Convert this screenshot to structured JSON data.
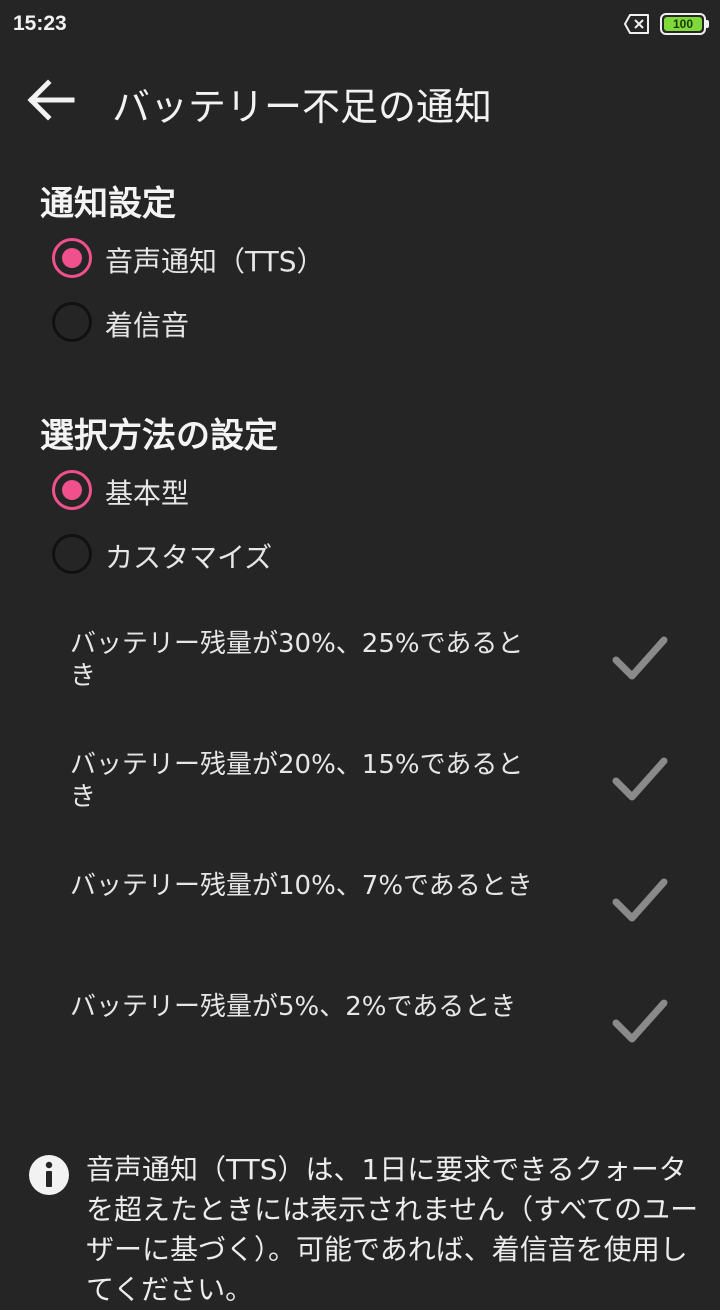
{
  "status": {
    "time": "15:23",
    "battery_level": "100"
  },
  "header": {
    "title": "バッテリー不足の通知"
  },
  "notification_settings": {
    "title": "通知設定",
    "options": [
      {
        "label": "音声通知（TTS）",
        "selected": true
      },
      {
        "label": "着信音",
        "selected": false
      }
    ]
  },
  "selection_method": {
    "title": "選択方法の設定",
    "options": [
      {
        "label": "基本型",
        "selected": true
      },
      {
        "label": "カスタマイズ",
        "selected": false
      }
    ]
  },
  "thresholds": [
    {
      "label": "バッテリー残量が30%、25%であるとき",
      "checked": true
    },
    {
      "label": "バッテリー残量が20%、15%であるとき",
      "checked": true
    },
    {
      "label": "バッテリー残量が10%、7%であるとき",
      "checked": true
    },
    {
      "label": "バッテリー残量が5%、2%であるとき",
      "checked": true
    }
  ],
  "info": {
    "text": "音声通知（TTS）は、1日に要求できるクォータを超えたときには表示されません（すべてのユーザーに基づく）。可能であれば、着信音を使用してください。"
  },
  "colors": {
    "background": "#252525",
    "accent": "#f0508c",
    "battery": "#7fd93a",
    "checkmark": "#8a8a8a"
  }
}
